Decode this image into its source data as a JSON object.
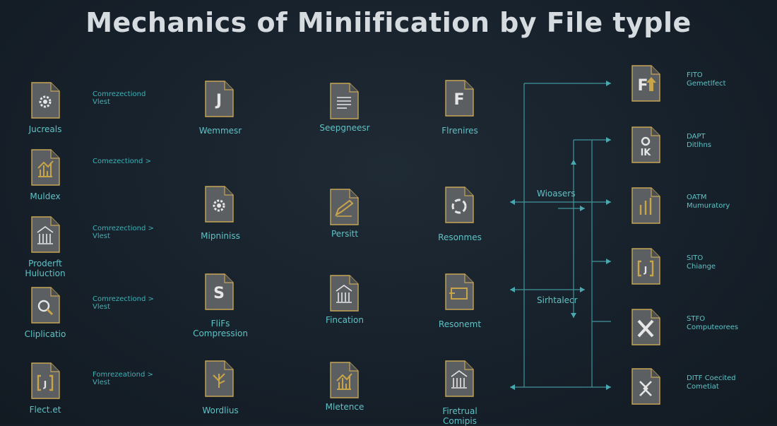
{
  "title": "Mechanics of Miniification by File typle",
  "colors": {
    "teal": "#5fc3c6",
    "gold": "#c9a54a",
    "doc": "#5b5f62",
    "bg": "#17212b"
  },
  "col1": [
    {
      "label": "Jucreals",
      "icon": "gear-bug-icon",
      "note": [
        "Comrezectiond",
        "Vlest"
      ]
    },
    {
      "label": "Muldex",
      "icon": "bar-chart-icon",
      "note": [
        "Comezectiond >"
      ]
    },
    {
      "label": [
        "Proderft",
        "Huluction"
      ],
      "icon": "building-icon",
      "note": [
        "Comrezectiond >",
        "Vlest"
      ]
    },
    {
      "label": "Cliplicatio",
      "icon": "magnifier-icon",
      "note": [
        "Comrezectiond >",
        "Vlest"
      ]
    },
    {
      "label": "Flect.et",
      "icon": "bracket-icon",
      "note": [
        "Fomrezeationd >",
        "Vlest"
      ]
    }
  ],
  "col2": [
    {
      "label": "Wemmesr",
      "icon": "letter-j-icon"
    },
    {
      "label": "Mipniniss",
      "icon": "gear-icon"
    },
    {
      "label": [
        "FliFs",
        "Compression"
      ],
      "icon": "letter-s-icon"
    },
    {
      "label": "Wordlius",
      "icon": "tree-icon"
    }
  ],
  "col3": [
    {
      "label": "Seepgneesr",
      "icon": "lines-icon"
    },
    {
      "label": "Persitt",
      "icon": "pencil-icon"
    },
    {
      "label": "Fincation",
      "icon": "columns-icon"
    },
    {
      "label": "Mletence",
      "icon": "chart-icon"
    }
  ],
  "col4": [
    {
      "label": "Flrenires",
      "icon": "letter-f-icon"
    },
    {
      "label": "Resonmes",
      "icon": "recycle-icon"
    },
    {
      "label": "Resonemt",
      "icon": "card-icon"
    },
    {
      "label": [
        "Firetrual",
        "Comipis"
      ],
      "icon": "pillars-icon"
    }
  ],
  "flow": {
    "upper": "Wioasers",
    "lower": "Sirhtalecr"
  },
  "col5": [
    {
      "icon": "f-arrow-icon",
      "text": [
        "FITO",
        "Gemetlfect"
      ]
    },
    {
      "icon": "chart-letters-icon",
      "text": [
        "DAPT",
        "Ditlhns"
      ]
    },
    {
      "icon": "bars-icon",
      "text": [
        "OATM",
        "Mumuratory"
      ]
    },
    {
      "icon": "bracket-j-icon",
      "text": [
        "SITO",
        "Chiange"
      ]
    },
    {
      "icon": "x-icon",
      "text": [
        "STFO",
        "Computeorees"
      ]
    },
    {
      "icon": "arrows-icon",
      "text": [
        "DITF Coecited",
        "Cometiat"
      ]
    }
  ]
}
